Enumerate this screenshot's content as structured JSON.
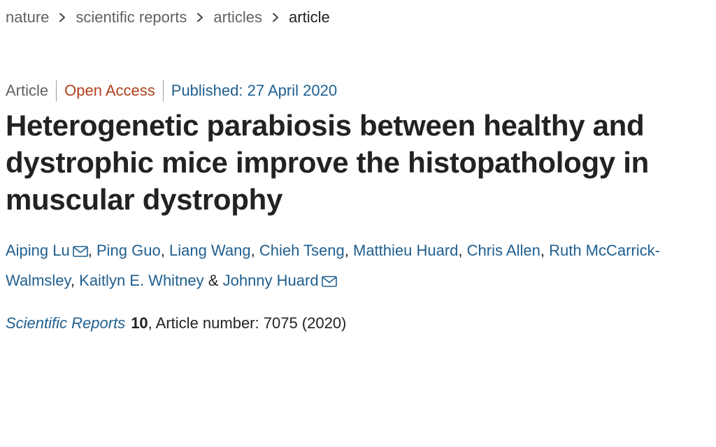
{
  "breadcrumb": {
    "items": [
      {
        "label": "nature"
      },
      {
        "label": "scientific reports"
      },
      {
        "label": "articles"
      },
      {
        "label": "article"
      }
    ],
    "separator_icon": "chevron-right-icon"
  },
  "meta": {
    "type": "Article",
    "access": "Open Access",
    "published": "Published: 27 April 2020"
  },
  "title": "Heterogenetic parabiosis between healthy and dystrophic mice improve the histopathology in muscular dystrophy",
  "authors": {
    "list": [
      {
        "name": "Aiping Lu",
        "mail_icon": "envelope-icon"
      },
      {
        "name": "Ping Guo"
      },
      {
        "name": "Liang Wang"
      },
      {
        "name": "Chieh Tseng"
      },
      {
        "name": "Matthieu Huard"
      },
      {
        "name": "Chris Allen"
      },
      {
        "name": "Ruth McCarrick-Walmsley"
      },
      {
        "name": "Kaitlyn E. Whitney"
      },
      {
        "name": "Johnny Huard",
        "mail_icon": "envelope-icon"
      }
    ],
    "comma": ",",
    "and": "&"
  },
  "citation": {
    "journal": "Scientific Reports",
    "volume": "10",
    "details": ", Article number: 7075 (2020)"
  },
  "colors": {
    "link": "#1f5f8f",
    "open_access": "#b0421e",
    "muted": "#626262",
    "text": "#222222"
  }
}
